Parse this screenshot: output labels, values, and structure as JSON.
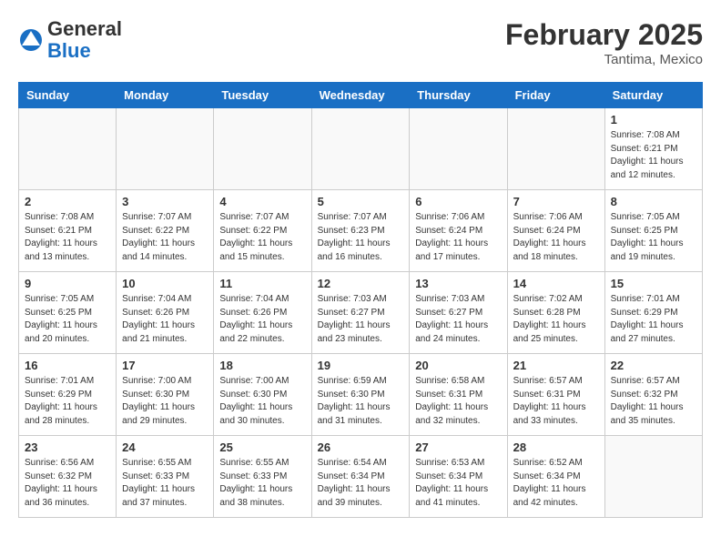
{
  "header": {
    "logo_general": "General",
    "logo_blue": "Blue",
    "month_title": "February 2025",
    "location": "Tantima, Mexico"
  },
  "weekdays": [
    "Sunday",
    "Monday",
    "Tuesday",
    "Wednesday",
    "Thursday",
    "Friday",
    "Saturday"
  ],
  "weeks": [
    [
      {
        "day": "",
        "info": ""
      },
      {
        "day": "",
        "info": ""
      },
      {
        "day": "",
        "info": ""
      },
      {
        "day": "",
        "info": ""
      },
      {
        "day": "",
        "info": ""
      },
      {
        "day": "",
        "info": ""
      },
      {
        "day": "1",
        "info": "Sunrise: 7:08 AM\nSunset: 6:21 PM\nDaylight: 11 hours\nand 12 minutes."
      }
    ],
    [
      {
        "day": "2",
        "info": "Sunrise: 7:08 AM\nSunset: 6:21 PM\nDaylight: 11 hours\nand 13 minutes."
      },
      {
        "day": "3",
        "info": "Sunrise: 7:07 AM\nSunset: 6:22 PM\nDaylight: 11 hours\nand 14 minutes."
      },
      {
        "day": "4",
        "info": "Sunrise: 7:07 AM\nSunset: 6:22 PM\nDaylight: 11 hours\nand 15 minutes."
      },
      {
        "day": "5",
        "info": "Sunrise: 7:07 AM\nSunset: 6:23 PM\nDaylight: 11 hours\nand 16 minutes."
      },
      {
        "day": "6",
        "info": "Sunrise: 7:06 AM\nSunset: 6:24 PM\nDaylight: 11 hours\nand 17 minutes."
      },
      {
        "day": "7",
        "info": "Sunrise: 7:06 AM\nSunset: 6:24 PM\nDaylight: 11 hours\nand 18 minutes."
      },
      {
        "day": "8",
        "info": "Sunrise: 7:05 AM\nSunset: 6:25 PM\nDaylight: 11 hours\nand 19 minutes."
      }
    ],
    [
      {
        "day": "9",
        "info": "Sunrise: 7:05 AM\nSunset: 6:25 PM\nDaylight: 11 hours\nand 20 minutes."
      },
      {
        "day": "10",
        "info": "Sunrise: 7:04 AM\nSunset: 6:26 PM\nDaylight: 11 hours\nand 21 minutes."
      },
      {
        "day": "11",
        "info": "Sunrise: 7:04 AM\nSunset: 6:26 PM\nDaylight: 11 hours\nand 22 minutes."
      },
      {
        "day": "12",
        "info": "Sunrise: 7:03 AM\nSunset: 6:27 PM\nDaylight: 11 hours\nand 23 minutes."
      },
      {
        "day": "13",
        "info": "Sunrise: 7:03 AM\nSunset: 6:27 PM\nDaylight: 11 hours\nand 24 minutes."
      },
      {
        "day": "14",
        "info": "Sunrise: 7:02 AM\nSunset: 6:28 PM\nDaylight: 11 hours\nand 25 minutes."
      },
      {
        "day": "15",
        "info": "Sunrise: 7:01 AM\nSunset: 6:29 PM\nDaylight: 11 hours\nand 27 minutes."
      }
    ],
    [
      {
        "day": "16",
        "info": "Sunrise: 7:01 AM\nSunset: 6:29 PM\nDaylight: 11 hours\nand 28 minutes."
      },
      {
        "day": "17",
        "info": "Sunrise: 7:00 AM\nSunset: 6:30 PM\nDaylight: 11 hours\nand 29 minutes."
      },
      {
        "day": "18",
        "info": "Sunrise: 7:00 AM\nSunset: 6:30 PM\nDaylight: 11 hours\nand 30 minutes."
      },
      {
        "day": "19",
        "info": "Sunrise: 6:59 AM\nSunset: 6:30 PM\nDaylight: 11 hours\nand 31 minutes."
      },
      {
        "day": "20",
        "info": "Sunrise: 6:58 AM\nSunset: 6:31 PM\nDaylight: 11 hours\nand 32 minutes."
      },
      {
        "day": "21",
        "info": "Sunrise: 6:57 AM\nSunset: 6:31 PM\nDaylight: 11 hours\nand 33 minutes."
      },
      {
        "day": "22",
        "info": "Sunrise: 6:57 AM\nSunset: 6:32 PM\nDaylight: 11 hours\nand 35 minutes."
      }
    ],
    [
      {
        "day": "23",
        "info": "Sunrise: 6:56 AM\nSunset: 6:32 PM\nDaylight: 11 hours\nand 36 minutes."
      },
      {
        "day": "24",
        "info": "Sunrise: 6:55 AM\nSunset: 6:33 PM\nDaylight: 11 hours\nand 37 minutes."
      },
      {
        "day": "25",
        "info": "Sunrise: 6:55 AM\nSunset: 6:33 PM\nDaylight: 11 hours\nand 38 minutes."
      },
      {
        "day": "26",
        "info": "Sunrise: 6:54 AM\nSunset: 6:34 PM\nDaylight: 11 hours\nand 39 minutes."
      },
      {
        "day": "27",
        "info": "Sunrise: 6:53 AM\nSunset: 6:34 PM\nDaylight: 11 hours\nand 41 minutes."
      },
      {
        "day": "28",
        "info": "Sunrise: 6:52 AM\nSunset: 6:34 PM\nDaylight: 11 hours\nand 42 minutes."
      },
      {
        "day": "",
        "info": ""
      }
    ]
  ]
}
